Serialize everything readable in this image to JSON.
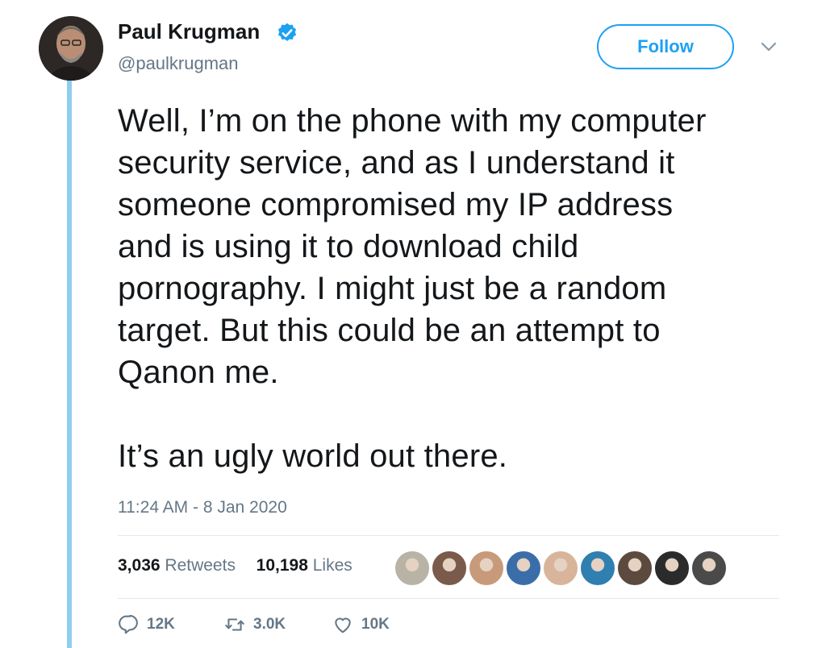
{
  "user": {
    "display_name": "Paul Krugman",
    "handle": "@paulkrugman",
    "verified": true
  },
  "header": {
    "follow_label": "Follow"
  },
  "tweet": {
    "paragraph1": [
      "Well, I’m on the phone with my computer",
      "security service, and as I understand it",
      "someone compromised my IP address",
      "and is using it to download child",
      "pornography. I might just be a random",
      "target. But this could be an attempt to",
      "Qanon me."
    ],
    "paragraph2": "It’s an ugly world out there.",
    "timestamp": "11:24 AM - 8 Jan 2020"
  },
  "stats": {
    "retweets_count": "3,036",
    "retweets_label": "Retweets",
    "likes_count": "10,198",
    "likes_label": "Likes"
  },
  "likers": [
    {
      "name": "liker-avatar-1",
      "color": "#b9b3a6"
    },
    {
      "name": "liker-avatar-2",
      "color": "#7a5a4a"
    },
    {
      "name": "liker-avatar-3",
      "color": "#c79a7a"
    },
    {
      "name": "liker-avatar-4",
      "color": "#3b6ea8"
    },
    {
      "name": "liker-avatar-5",
      "color": "#d8b59a"
    },
    {
      "name": "liker-avatar-6",
      "color": "#2f7fb0"
    },
    {
      "name": "liker-avatar-7",
      "color": "#5c4a3e"
    },
    {
      "name": "liker-avatar-8",
      "color": "#2b2b2b"
    },
    {
      "name": "liker-avatar-9",
      "color": "#4a4a4a"
    }
  ],
  "actions": {
    "replies": "12K",
    "retweets": "3.0K",
    "likes": "10K"
  },
  "colors": {
    "accent": "#1da1f2",
    "thread_line": "#8ecdf0",
    "muted_text": "#657786",
    "divider": "#e1e8ed"
  }
}
